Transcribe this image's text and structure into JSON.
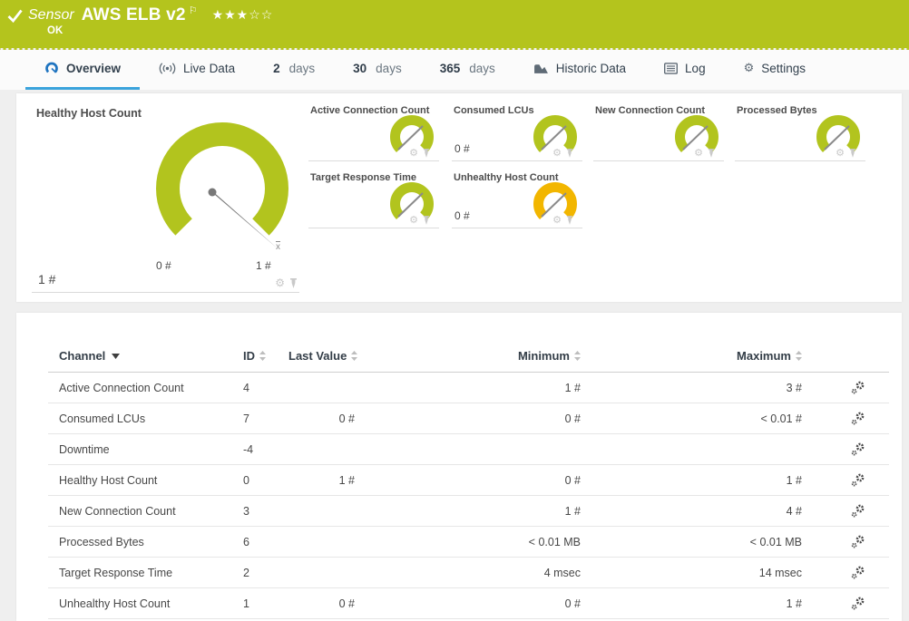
{
  "header": {
    "kind_label": "Sensor",
    "sensor_name": "AWS ELB v2",
    "status": "OK",
    "stars_filled": "★★★",
    "stars_empty": "☆☆"
  },
  "tabs": {
    "overview": {
      "label": "Overview"
    },
    "live_data": {
      "label": "Live Data"
    },
    "days2": {
      "num": "2",
      "word": "days"
    },
    "days30": {
      "num": "30",
      "word": "days"
    },
    "days365": {
      "num": "365",
      "word": "days"
    },
    "historic": {
      "label": "Historic Data"
    },
    "log": {
      "label": "Log"
    },
    "settings": {
      "label": "Settings"
    }
  },
  "gauges": {
    "main": {
      "title": "Healthy Host Count",
      "value": "1 #",
      "scale_min": "0 #",
      "scale_max": "1 #",
      "mean_marker": "x"
    },
    "small": [
      {
        "title": "Active Connection Count",
        "value": "",
        "color": "#b2c41e"
      },
      {
        "title": "Consumed LCUs",
        "value": "0 #",
        "color": "#b2c41e"
      },
      {
        "title": "New Connection Count",
        "value": "",
        "color": "#b2c41e"
      },
      {
        "title": "Processed Bytes",
        "value": "",
        "color": "#b2c41e"
      },
      {
        "title": "Target Response Time",
        "value": "",
        "color": "#b2c41e"
      },
      {
        "title": "Unhealthy Host Count",
        "value": "0 #",
        "color": "#f2b600"
      }
    ]
  },
  "table": {
    "headers": {
      "channel": "Channel",
      "id": "ID",
      "last_value": "Last Value",
      "minimum": "Minimum",
      "maximum": "Maximum"
    },
    "rows": [
      {
        "channel": "Active Connection Count",
        "id": "4",
        "last": "",
        "min": "1 #",
        "max": "3 #"
      },
      {
        "channel": "Consumed LCUs",
        "id": "7",
        "last": "0 #",
        "min": "0 #",
        "max": "< 0.01 #"
      },
      {
        "channel": "Downtime",
        "id": "-4",
        "last": "",
        "min": "",
        "max": ""
      },
      {
        "channel": "Healthy Host Count",
        "id": "0",
        "last": "1 #",
        "min": "0 #",
        "max": "1 #"
      },
      {
        "channel": "New Connection Count",
        "id": "3",
        "last": "",
        "min": "1 #",
        "max": "4 #"
      },
      {
        "channel": "Processed Bytes",
        "id": "6",
        "last": "",
        "min": "< 0.01 MB",
        "max": "< 0.01 MB"
      },
      {
        "channel": "Target Response Time",
        "id": "2",
        "last": "",
        "min": "4 msec",
        "max": "14 msec"
      },
      {
        "channel": "Unhealthy Host Count",
        "id": "1",
        "last": "0 #",
        "min": "0 #",
        "max": "1 #"
      }
    ]
  },
  "colors": {
    "header_green": "#b4c41d",
    "gauge_green": "#b2c41e",
    "warning_yellow": "#f2b600",
    "active_tab_blue": "#3aa3dc",
    "tab_icon_blue": "#1f74c0"
  }
}
